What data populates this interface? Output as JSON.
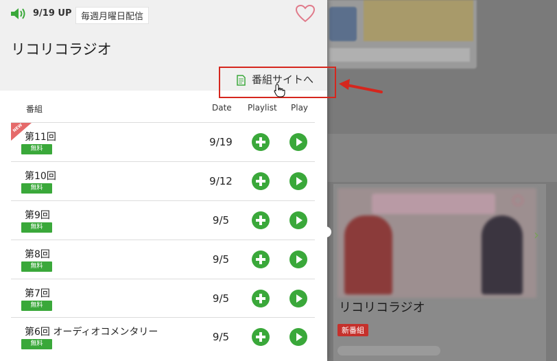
{
  "header": {
    "update_text": "9/19 UP",
    "weekly_badge": "毎週月曜日配信",
    "title": "リコリコラジオ",
    "site_link_label": "番組サイトへ"
  },
  "table": {
    "headers": {
      "program": "番組",
      "date": "Date",
      "playlist": "Playlist",
      "play": "Play"
    },
    "new_label": "NEW",
    "free_label": "無料",
    "rows": [
      {
        "title": "第11回",
        "date": "9/19"
      },
      {
        "title": "第10回",
        "date": "9/12"
      },
      {
        "title": "第9回",
        "date": "9/5"
      },
      {
        "title": "第8回",
        "date": "9/5"
      },
      {
        "title": "第7回",
        "date": "9/5"
      },
      {
        "title": "第6回 オーディオコメンタリー",
        "date": "9/5"
      }
    ]
  },
  "background": {
    "card_title": "リコリコラジオ",
    "card_badge": "新番組"
  },
  "colors": {
    "accent_green": "#3aa83a",
    "highlight_red": "#d5261d",
    "heart_pink": "#e07a8a"
  },
  "icons": [
    "speaker-icon",
    "heart-icon",
    "document-icon",
    "plus-icon",
    "play-icon",
    "cursor-hand-icon",
    "arrow-left-icon"
  ]
}
